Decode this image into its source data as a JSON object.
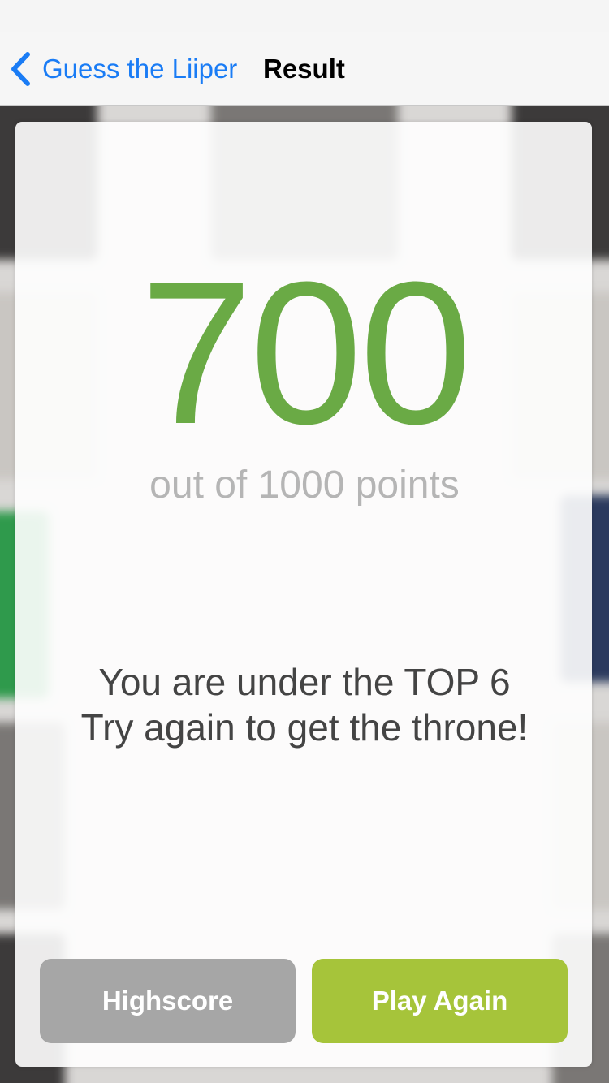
{
  "nav": {
    "back_label": "Guess the Liiper",
    "title": "Result"
  },
  "result": {
    "score": "700",
    "subtitle": "out of 1000 points",
    "message_line1": "You are under the TOP 6",
    "message_line2": "Try again to get the throne!"
  },
  "buttons": {
    "highscore_label": "Highscore",
    "play_again_label": "Play Again"
  },
  "colors": {
    "accent_blue": "#1a7cf5",
    "score_green": "#6aaa45",
    "play_again_green": "#a6c43a",
    "highscore_gray": "#a6a6a6"
  },
  "icons": {
    "back": "chevron-left-icon"
  }
}
